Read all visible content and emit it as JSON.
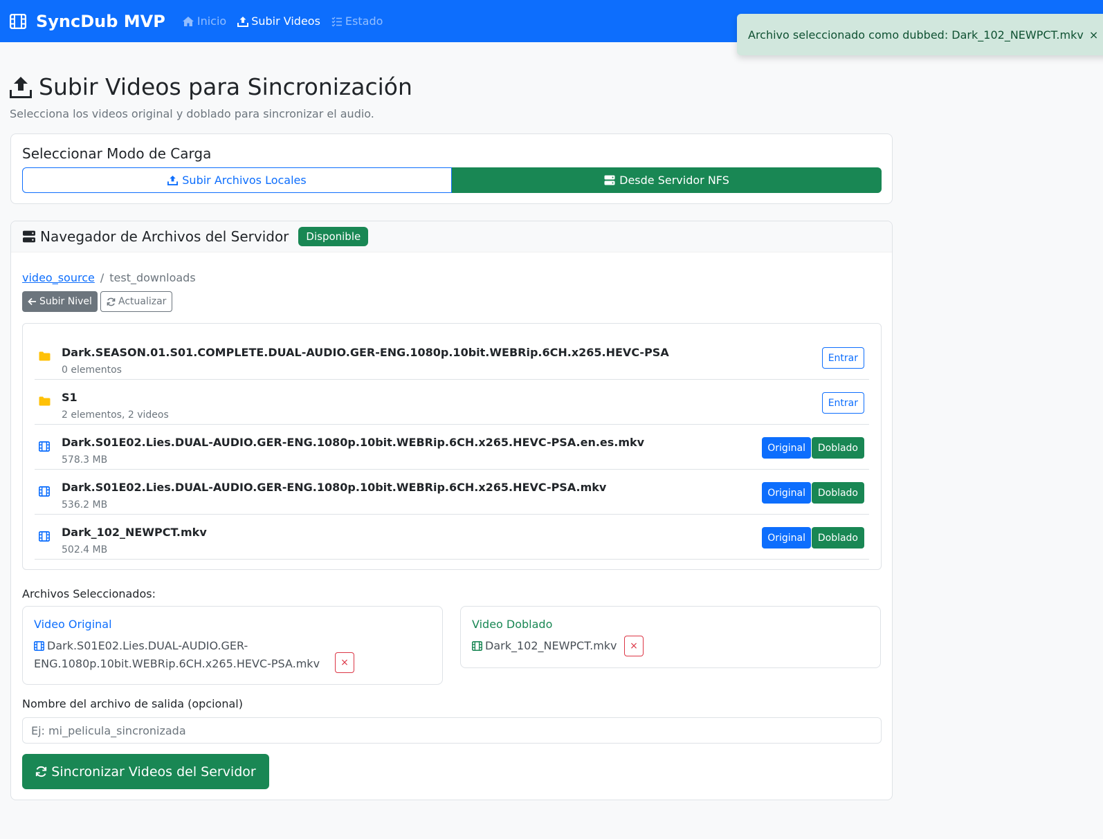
{
  "navbar": {
    "brand": "SyncDub MVP",
    "links": [
      {
        "label": "Inicio",
        "icon": "home-icon",
        "active": false
      },
      {
        "label": "Subir Videos",
        "icon": "upload-icon",
        "active": true
      },
      {
        "label": "Estado",
        "icon": "list-check-icon",
        "active": false
      }
    ]
  },
  "toast": {
    "message": "Archivo seleccionado como dubbed: Dark_102_NEWPCT.mkv",
    "close_label": "×"
  },
  "page": {
    "title": "Subir Videos para Sincronización",
    "subtitle": "Selecciona los videos original y doblado para sincronizar el audio."
  },
  "mode_card": {
    "title": "Seleccionar Modo de Carga",
    "local_label": "Subir Archivos Locales",
    "nfs_label": "Desde Servidor NFS",
    "selected": "nfs"
  },
  "browser": {
    "title": "Navegador de Archivos del Servidor",
    "status_badge": "Disponible",
    "breadcrumb": {
      "root": "video_source",
      "separator": "/",
      "current": "test_downloads"
    },
    "up_label": "Subir Nivel",
    "refresh_label": "Actualizar",
    "enter_label": "Entrar",
    "original_label": "Original",
    "doblado_label": "Doblado",
    "items": [
      {
        "type": "folder",
        "name": "Dark.SEASON.01.S01.COMPLETE.DUAL-AUDIO.GER-ENG.1080p.10bit.WEBRip.6CH.x265.HEVC-PSA",
        "meta": "0 elementos"
      },
      {
        "type": "folder",
        "name": "S1",
        "meta": "2 elementos, 2 videos"
      },
      {
        "type": "video",
        "name": "Dark.S01E02.Lies.DUAL-AUDIO.GER-ENG.1080p.10bit.WEBRip.6CH.x265.HEVC-PSA.en.es.mkv",
        "meta": "578.3 MB"
      },
      {
        "type": "video",
        "name": "Dark.S01E02.Lies.DUAL-AUDIO.GER-ENG.1080p.10bit.WEBRip.6CH.x265.HEVC-PSA.mkv",
        "meta": "536.2 MB"
      },
      {
        "type": "video",
        "name": "Dark_102_NEWPCT.mkv",
        "meta": "502.4 MB"
      }
    ]
  },
  "selected": {
    "label": "Archivos Seleccionados:",
    "original": {
      "title": "Video Original",
      "file": "Dark.S01E02.Lies.DUAL-AUDIO.GER-ENG.1080p.10bit.WEBRip.6CH.x265.HEVC-PSA.mkv",
      "remove_label": "×"
    },
    "dubbed": {
      "title": "Video Doblado",
      "file": "Dark_102_NEWPCT.mkv",
      "remove_label": "×"
    }
  },
  "output": {
    "label": "Nombre del archivo de salida (opcional)",
    "value": "",
    "placeholder": "Ej: mi_pelicula_sincronizada"
  },
  "sync_button": "Sincronizar Videos del Servidor",
  "colors": {
    "primary": "#0d6efd",
    "success": "#198754",
    "secondary": "#6c757d",
    "danger": "#dc3545",
    "folder": "#ffc107",
    "toast_bg": "#d1e7dd"
  }
}
